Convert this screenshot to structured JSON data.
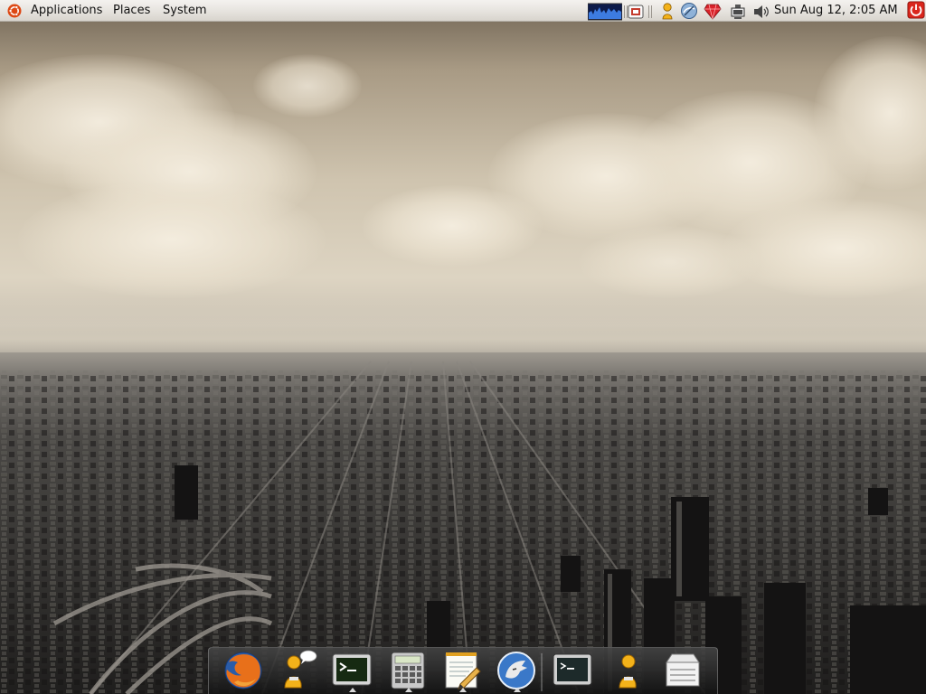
{
  "panel": {
    "menus": {
      "applications": "Applications",
      "places": "Places",
      "system": "System"
    },
    "tray_icons": [
      "system-monitor-graph-icon",
      "screen-capture-icon",
      "pidgin-buddy-icon",
      "network-globe-icon",
      "ruby-gem-icon",
      "network-connection-icon",
      "volume-speaker-icon"
    ],
    "clock": "Sun Aug 12,  2:05 AM",
    "power_icon": "power-icon"
  },
  "dock": {
    "launchers": [
      "firefox-icon",
      "pidgin-icon",
      "terminal-icon",
      "calculator-icon",
      "text-editor-icon",
      "mail-client-icon"
    ],
    "running": [
      "terminal-icon",
      "pidgin-icon",
      "drive-icon"
    ]
  },
  "colors": {
    "panel_bg": "#e6e3de",
    "accent_orange": "#dd4814",
    "power_red": "#d9261c",
    "dock_bg": "#2a2a2a"
  }
}
